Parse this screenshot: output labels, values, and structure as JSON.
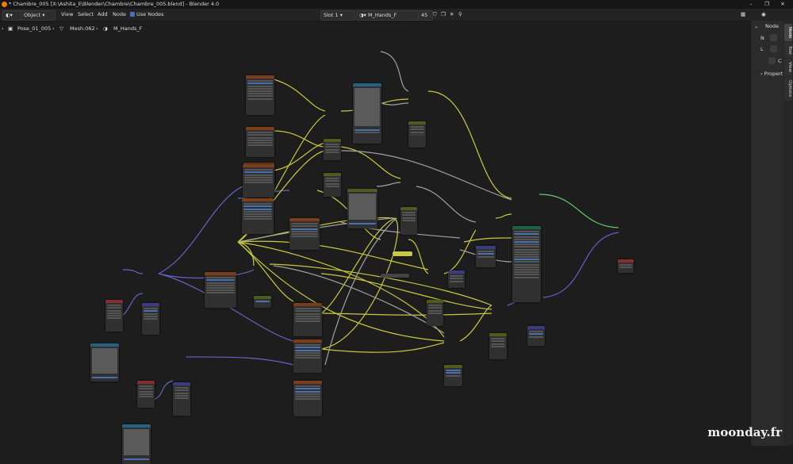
{
  "window": {
    "title": "* Chambre_005 [X:\\Ashita_E\\Blender\\Chambre\\Chambre_005.blend] - Blender 4.0",
    "minimize": "–",
    "maximize": "❐",
    "close": "✕"
  },
  "header": {
    "mode": "Object",
    "menus": [
      "View",
      "Select",
      "Add",
      "Node"
    ],
    "use_nodes_label": "Use Nodes",
    "slot": "Slot 1",
    "material": "M_Hands_F",
    "users": "45"
  },
  "breadcrumb": {
    "items": [
      "Pose_01_005",
      "Mesh.062",
      "M_Hands_F"
    ]
  },
  "sidebar": {
    "panel_title": "Node",
    "row1": "N",
    "row2": "L",
    "row3": "C",
    "properties": "Propert",
    "tabs": [
      "Node",
      "Tool",
      "View",
      "Options"
    ]
  },
  "watermark": "moonday.fr",
  "colors": {
    "accent": "#4772b3",
    "wire_yellow": "#c8c841",
    "wire_purple": "#6363c7",
    "wire_gray": "#a1a1a1",
    "wire_green": "#63c763",
    "header_brown": "#7a3e1d",
    "header_teal": "#246283",
    "header_red": "#832f2f",
    "header_olive": "#4f5a1f",
    "header_green": "#1b6545",
    "header_blue": "#3c3c83"
  }
}
